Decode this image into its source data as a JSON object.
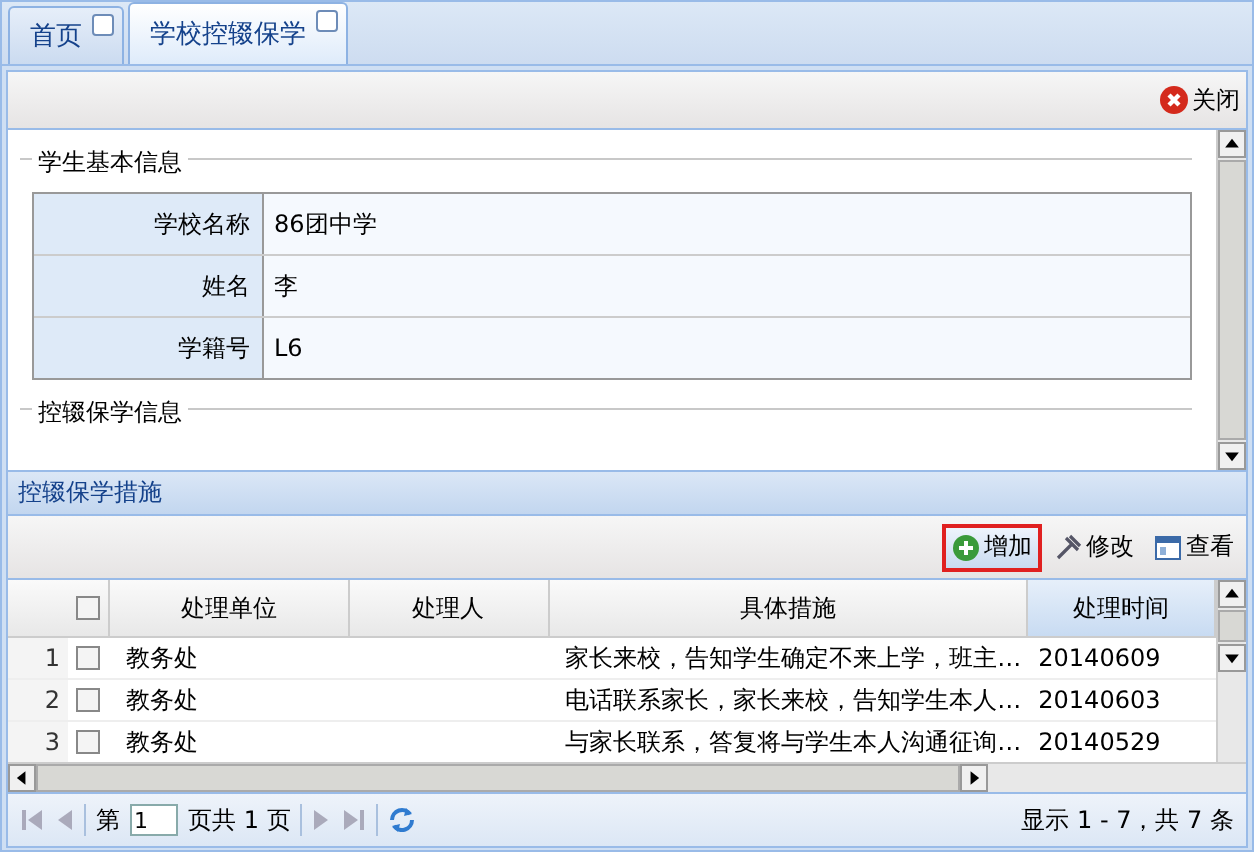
{
  "tabs": [
    {
      "label": "首页",
      "selected": false
    },
    {
      "label": "学校控辍保学",
      "selected": true
    }
  ],
  "panel_toolbar": {
    "close": "关闭"
  },
  "sections": [
    {
      "title": "学生基本信息",
      "fields": [
        {
          "label": "学校名称",
          "value": "86团中学"
        },
        {
          "label": "姓名",
          "value": "李"
        },
        {
          "label": "学籍号",
          "value": "L6"
        }
      ]
    },
    {
      "title": "控辍保学信息"
    }
  ],
  "grid": {
    "title": "控辍保学措施",
    "toolbar": [
      {
        "kind": "add",
        "label": "增加",
        "highlighted": true
      },
      {
        "kind": "edit",
        "label": "修改",
        "highlighted": false
      },
      {
        "kind": "view",
        "label": "查看",
        "highlighted": false
      }
    ],
    "all_checked": false,
    "columns": [
      {
        "label": "处理单位",
        "sorted": false
      },
      {
        "label": "处理人",
        "sorted": false
      },
      {
        "label": "具体措施",
        "sorted": false
      },
      {
        "label": "处理时间",
        "sorted": true
      }
    ],
    "rows": [
      {
        "number": "1",
        "checked": false,
        "cells": [
          "教务处",
          "",
          "家长来校，告知学生确定不来上学，班主…",
          "20140609"
        ]
      },
      {
        "number": "2",
        "checked": false,
        "cells": [
          "教务处",
          "",
          "电话联系家长，家长来校，告知学生本人…",
          "20140603"
        ]
      },
      {
        "number": "3",
        "checked": false,
        "cells": [
          "教务处",
          "",
          "与家长联系，答复将与学生本人沟通征询…",
          "20140529"
        ]
      }
    ],
    "paging": {
      "before": "第",
      "page": "1",
      "after": "页共 1 页",
      "summary": "显示 1 - 7，共 7 条"
    }
  }
}
